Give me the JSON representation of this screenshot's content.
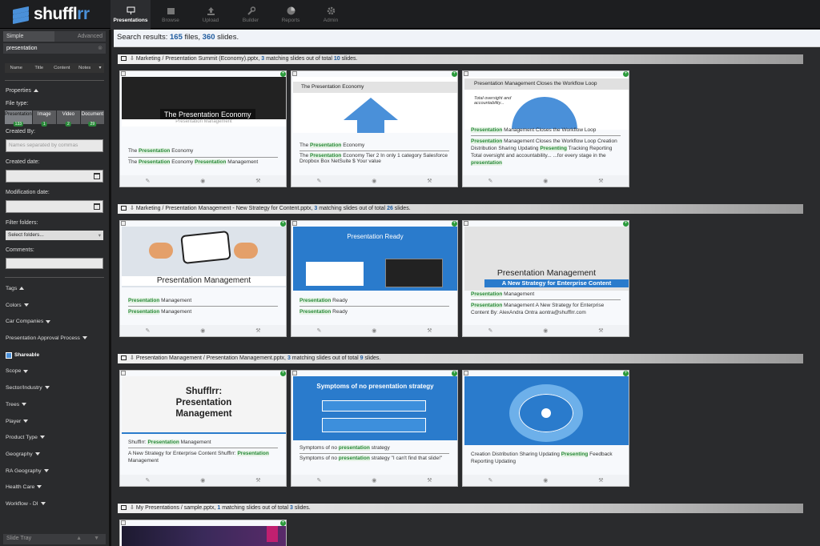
{
  "topbar": {
    "logo": {
      "main": "shuffl",
      "accent": "rr"
    },
    "nav": [
      {
        "label": "Presentations",
        "icon": "presentation-icon"
      },
      {
        "label": "Browse",
        "icon": "browse-icon"
      },
      {
        "label": "Upload",
        "icon": "upload-icon"
      },
      {
        "label": "Builder",
        "icon": "wrench-icon"
      },
      {
        "label": "Reports",
        "icon": "pie-chart-icon"
      },
      {
        "label": "Admin",
        "icon": "gear-icon"
      }
    ]
  },
  "sidebar": {
    "tabs": {
      "simple": "Simple",
      "advanced": "Advanced"
    },
    "search_value": "presentation",
    "search_clear": "⊗",
    "fields": [
      "Name",
      "Title",
      "Content",
      "Notes"
    ],
    "properties": "Properties",
    "file_type_label": "File type:",
    "file_types": [
      {
        "label": "Presentation",
        "count": "133"
      },
      {
        "label": "Image",
        "count": "1"
      },
      {
        "label": "Video",
        "count": "2"
      },
      {
        "label": "Document",
        "count": "29"
      }
    ],
    "created_by_label": "Created By:",
    "created_by_placeholder": "Names separated by commas",
    "created_date_label": "Created date:",
    "modification_date_label": "Modification date:",
    "filter_folders_label": "Filter folders:",
    "filter_folders_value": "Select folders...",
    "comments_label": "Comments:",
    "tags_label": "Tags",
    "tags": [
      "Colors",
      "Car Companies",
      "Presentation Approval Process"
    ],
    "shareable": "Shareable",
    "tags2": [
      "Scope",
      "Sector/Industry",
      "Trees",
      "Player",
      "Product Type",
      "Geography",
      "RA Geography",
      "Health Care",
      "Workflow - DI"
    ],
    "slide_tray": "Slide Tray"
  },
  "results": {
    "prefix": "Search results: ",
    "files": "165",
    "files_word": " files, ",
    "slides": "360",
    "slides_word": " slides."
  },
  "groups": [
    {
      "path": "Marketing / Presentation Summit (Economy).pptx",
      "matching": "3",
      "middle": " matching slides out of total ",
      "total": "10",
      "end": " slides.",
      "cards": [
        {
          "thumb_title": "The Presentation Economy",
          "thumb_sub": "Presentation Management",
          "l1a": "The ",
          "l1h": "Presentation",
          "l1b": " Economy",
          "l2a": "The ",
          "l2h": "Presentation",
          "l2b": " Economy ",
          "l2h2": "Presentation",
          "l2c": " Management"
        },
        {
          "thumb_title": "The Presentation Economy",
          "l1a": "The ",
          "l1h": "Presentation",
          "l1b": " Economy",
          "l2a": "The ",
          "l2h": "Presentation",
          "l2b": " Economy Tier 2 In only 1 category Salesforce Dropbox Box NetSuite $ Your value"
        },
        {
          "thumb_title": "Presentation Management Closes the Workflow Loop",
          "thumb_note": "Total oversight and accountability...",
          "l1h": "Presentation",
          "l1b": " Management Closes the Workflow Loop",
          "l2h": "Presentation",
          "l2b": " Management Closes the Workflow Loop Creation Distribution Sharing Updating ",
          "l2h2": "Presenting",
          "l2c": " Tracking Reporting Total oversight and accountability... ...for every stage in the ",
          "l2h3": "presentation"
        }
      ]
    },
    {
      "path": "Marketing / Presentation Management - New Strategy for Content.pptx",
      "matching": "3",
      "middle": " matching slides out of total ",
      "total": "26",
      "end": " slides.",
      "cards": [
        {
          "thumb_title": "Presentation Management",
          "l1h": "Presentation",
          "l1b": " Management",
          "l2h": "Presentation",
          "l2b": " Management"
        },
        {
          "thumb_title": "Presentation Ready",
          "l1h": "Presentation",
          "l1b": " Ready",
          "l2h": "Presentation",
          "l2b": " Ready"
        },
        {
          "thumb_title": "Presentation Management",
          "thumb_sub": "A New Strategy for Enterprise Content",
          "l1h": "Presentation",
          "l1b": " Management",
          "l2h": "Presentation",
          "l2b": " Management A New Strategy for Enterprise Content By: AlexAndra Ontra aontra@shufflrr.com"
        }
      ]
    },
    {
      "path": "Presentation Management / Presentation Management.pptx",
      "matching": "3",
      "middle": " matching slides out of total ",
      "total": "9",
      "end": " slides.",
      "cards": [
        {
          "thumb_title": "Shufflrr: Presentation Management",
          "l1a": "Shufflrr: ",
          "l1h": "Presentation",
          "l1b": " Management",
          "l2a": "A New Strategy for Enterprise Content Shufflrr: ",
          "l2h": "Presentation",
          "l2b": " Management"
        },
        {
          "thumb_title": "Symptoms of no presentation strategy",
          "l1a": "Symptoms of no ",
          "l1h": "presentation",
          "l1b": " strategy",
          "l2a": "Symptoms of no ",
          "l2h": "presentation",
          "l2b": " strategy \"I can't find that slide!\""
        },
        {
          "thumb_title": "",
          "l1a": "Creation Distribution Sharing Updating ",
          "l1h": "Presenting",
          "l1b": " Feedback Reporting Updating"
        }
      ]
    },
    {
      "path": "My Presentations / sample.pptx",
      "matching": "1",
      "middle": " matching slides out of total ",
      "total": "3",
      "end": " slides.",
      "cards": []
    }
  ],
  "colors": {
    "accent": "#4a90d9",
    "highlight": "#2a8a3a",
    "link": "#1e5b9e"
  }
}
